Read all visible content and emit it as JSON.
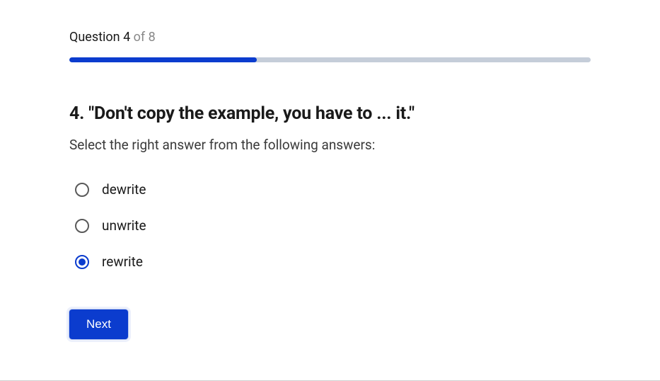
{
  "counter": {
    "prefix": "Question ",
    "current": "4",
    "of_total": " of 8"
  },
  "progress": {
    "percent": 36
  },
  "question": {
    "title": "4. \"Don't copy the example, you have to ... it.\"",
    "subtitle": "Select the right answer from the following answers:"
  },
  "options": [
    {
      "label": "dewrite",
      "selected": false
    },
    {
      "label": "unwrite",
      "selected": false
    },
    {
      "label": "rewrite",
      "selected": true
    }
  ],
  "buttons": {
    "next": "Next"
  }
}
